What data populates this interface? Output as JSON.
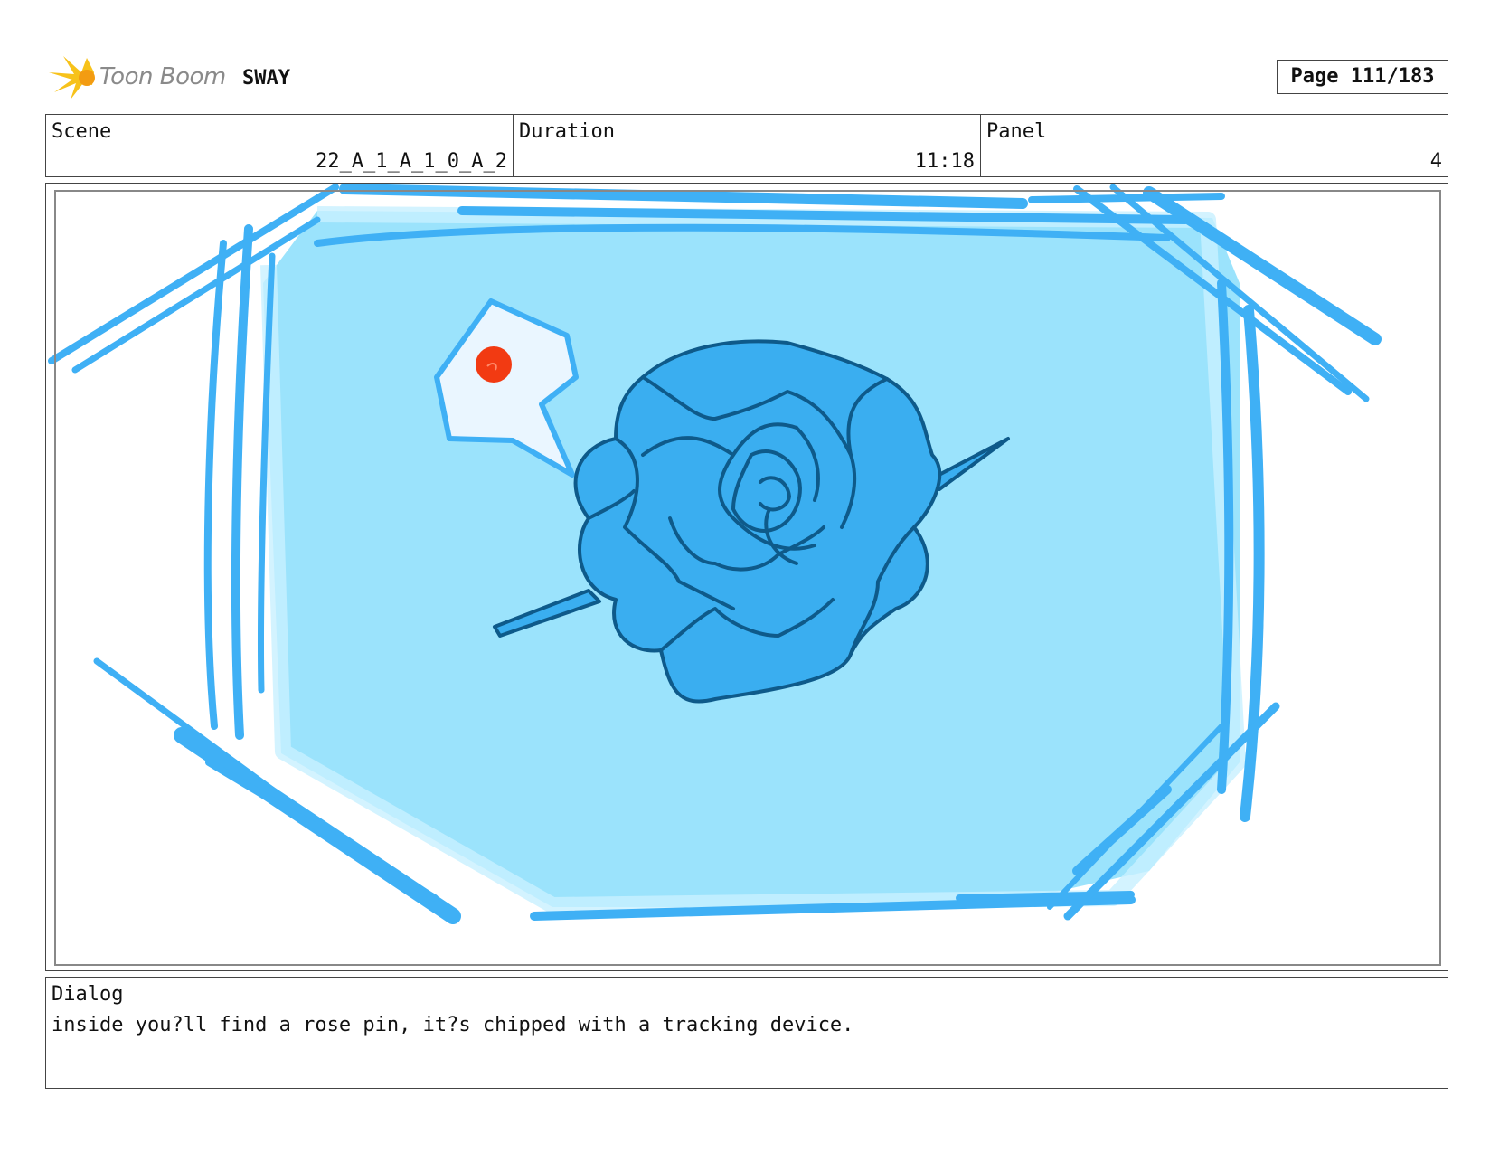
{
  "header": {
    "brand": "Toon Boom",
    "project": "SWAY",
    "page_label": "Page 111/183"
  },
  "info": {
    "scene_label": "Scene",
    "scene_value": "22_A_1_A_1_0_A_2",
    "duration_label": "Duration",
    "duration_value": "11:18",
    "panel_label": "Panel",
    "panel_value": "4"
  },
  "dialog": {
    "label": "Dialog",
    "text": "inside you?ll find a rose pin, it?s chipped with a tracking device."
  },
  "colors": {
    "frame_blue": "#3fb0f5",
    "sky_fill": "#9be3fc",
    "rose_fill": "#3aaef0",
    "rose_outline": "#0e5a8a",
    "bubble_fill": "#eaf6ff",
    "dot_red": "#f23a12"
  }
}
